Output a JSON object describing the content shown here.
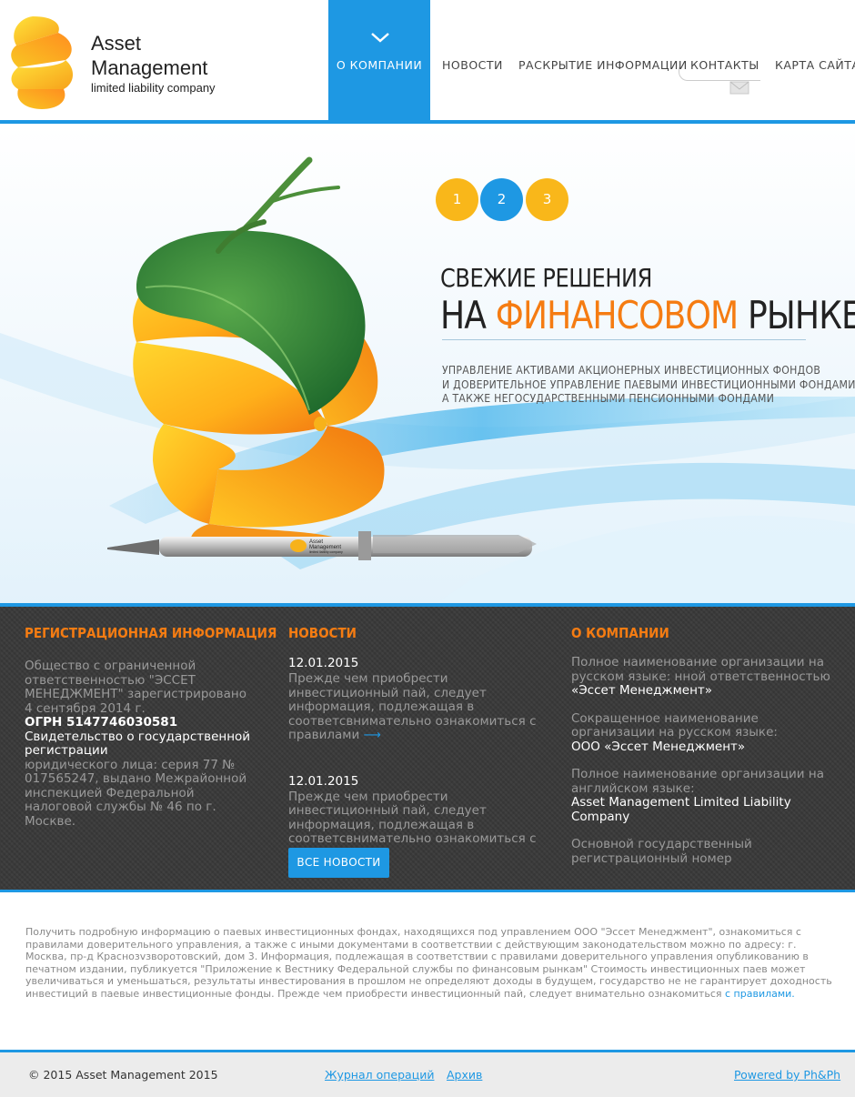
{
  "brand": {
    "line1": "Asset",
    "line2": "Management",
    "line3": "limited liability company"
  },
  "nav": {
    "items": [
      "О КОМПАНИИ",
      "НОВОСТИ",
      "РАСКРЫТИЕ ИНФОРМАЦИИ",
      "КОНТАКТЫ",
      "КАРТА САЙТА"
    ],
    "active": "О КОМПАНИИ"
  },
  "colors": {
    "accent_blue": "#1e98e3",
    "accent_orange": "#f57c12",
    "dot_yellow": "#f9b71a"
  },
  "slider": {
    "dots": [
      "1",
      "2",
      "3"
    ],
    "active_dot": "2",
    "headline1": "СВЕЖИЕ РЕШЕНИЯ",
    "headline2_pre": "НА ",
    "headline2_accent": "ФИНАНСОВОМ",
    "headline2_post": " РЫНКЕ",
    "subtitle": [
      "УПРАВЛЕНИЕ АКТИВАМИ АКЦИОНЕРНЫХ ИНВЕСТИЦИОННЫХ ФОНДОВ",
      "И ДОВЕРИТЕЛЬНОЕ УПРАВЛЕНИЕ ПАЕВЫМИ ИНВЕСТИЦИОННЫМИ ФОНДАМИ,",
      "А ТАКЖЕ НЕГОСУДАРСТВЕННЫМИ ПЕНСИОННЫМИ ФОНДАМИ"
    ],
    "pen_engraving": [
      "Asset",
      "Management",
      "limited liability company"
    ]
  },
  "registration": {
    "title": "РЕГИСТРАЦИОННАЯ ИНФОРМАЦИЯ",
    "text1": "Общество с ограниченной ответственностью \"ЭССЕТ МЕНЕДЖМЕНТ\" зарегистрировано 4 сентября 2014 г.",
    "ogrn": "ОГРН 5147746030581",
    "cert": "Свидетельство о государственной регистрации",
    "text2": "юридического лица: серия 77 № 017565247, выдано Межрайонной инспекцией Федеральной налоговой службы № 46 по г. Москве."
  },
  "news": {
    "title": "НОВОСТИ",
    "items": [
      {
        "date": "12.01.2015",
        "text": "Прежде чем приобрести инвестиционный пай, следует информация, подлежащая в соответсвнимательно ознакомиться с правилами",
        "arrow": "⟶"
      },
      {
        "date": "12.01.2015",
        "text": "Прежде чем приобрести инвестиционный пай, следует информация, подлежащая в соответсвнимательно ознакомиться с правилами",
        "arrow": "⟶"
      }
    ],
    "button": "ВСЕ НОВОСТИ"
  },
  "about": {
    "title": "О КОМПАНИИ",
    "fields": [
      {
        "label": "Полное наименование организации  на русском языке: нной ответственностью",
        "value": "«Эссет Менеджмент»"
      },
      {
        "label": "Сокращенное наименование организации на русском языке:",
        "value": "ООО «Эссет Менеджмент»"
      },
      {
        "label": "Полное наименование организации на английском языке:",
        "value": "Asset Management Limited Liability Company"
      },
      {
        "label": "Основной государственный регистрационный номер",
        "value": ""
      }
    ]
  },
  "disclaimer": {
    "text": "Получить подробную информацию о паевых инвестиционных фондах, находящихся под управлением ООО \"Эссет Менеджмент\", ознакомиться с правилами доверительного управления, а также с иными документами в соответствии с действующим законодательством можно по адресу: г. Москва, пр-д Краснозvзворотовский, дом 3. Информация, подлежащая в соответствии с правилами доверительного управления опубликованию в печатном издании, публикуется \"Приложение к Вестнику Федеральной службы по финансовым рынкам\" Стоимость инвестиционных паев может увеличиваться и уменьшаться, результаты инвестирования в прошлом не определяют доходы в будущем, государство не не гарантирует доходность инвестиций в паевые инвестиционные фонды. Прежде чем приобрести инвестиционный пай, следует внимательно ознакомиться",
    "link": "с правилами."
  },
  "footer": {
    "copyright": "© 2015 Asset Management 2015",
    "link_journal": "Журнал операций",
    "link_archive": "Архив",
    "powered": "Powered by Ph&Ph"
  }
}
